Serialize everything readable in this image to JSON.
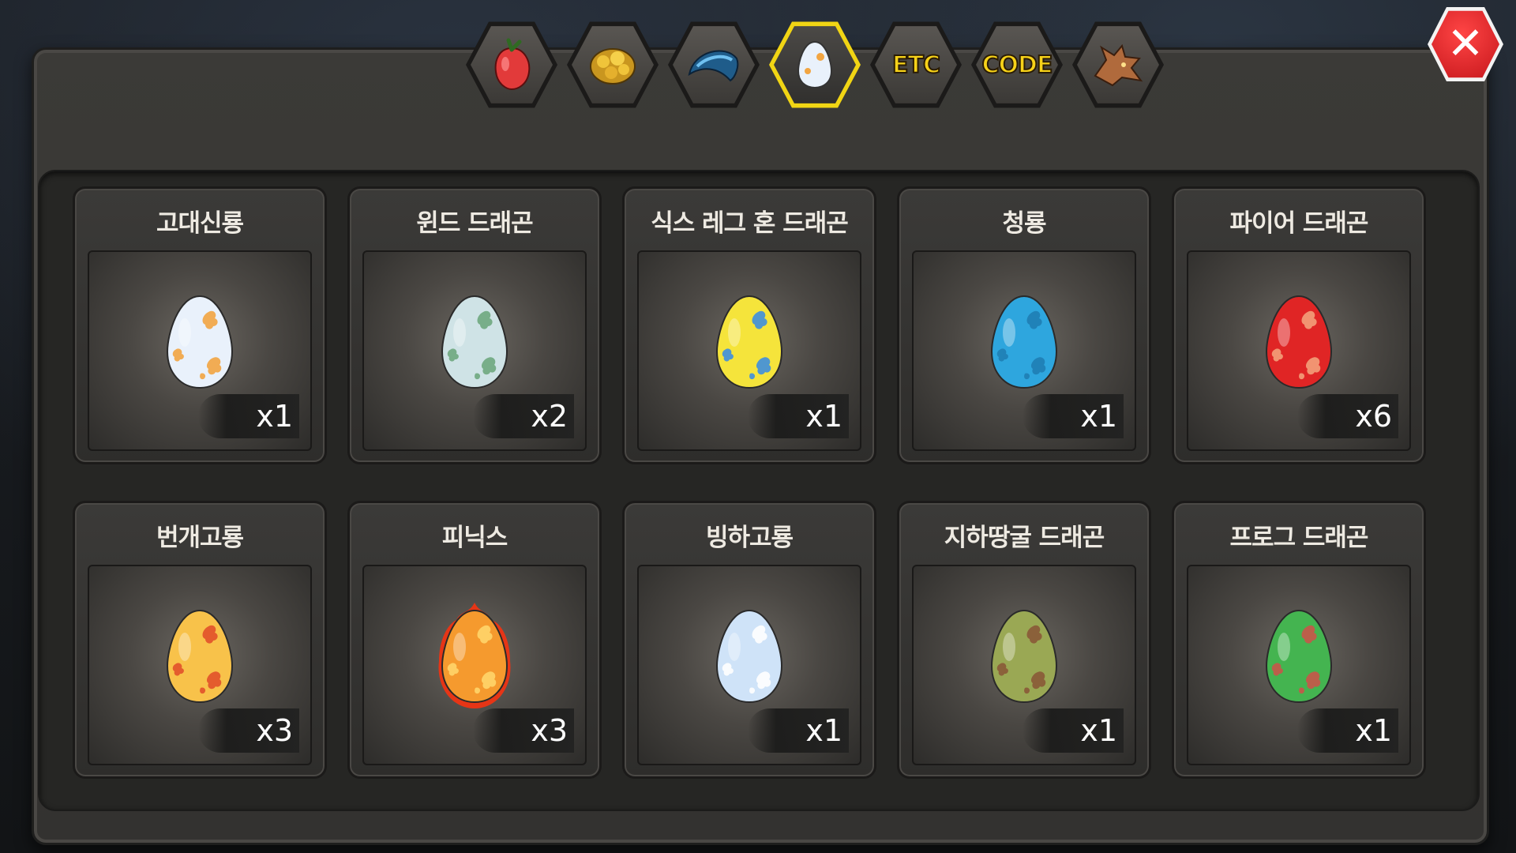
{
  "tabs": [
    {
      "name": "fruit-tab",
      "icon": "red-fruit-icon"
    },
    {
      "name": "gold-tab",
      "icon": "gold-nugget-icon"
    },
    {
      "name": "scale-tab",
      "icon": "blue-scale-icon"
    },
    {
      "name": "egg-tab",
      "icon": "egg-icon",
      "active": true
    },
    {
      "name": "etc-tab",
      "label": "ETC"
    },
    {
      "name": "code-tab",
      "label": "CODE"
    },
    {
      "name": "dragon-tab",
      "icon": "dragon-head-icon"
    }
  ],
  "close_icon": "close-x-icon",
  "eggs": [
    {
      "name": "고대신룡",
      "qty": "x1",
      "base": "#e9f1fb",
      "spot": "#f2a542"
    },
    {
      "name": "윈드 드래곤",
      "qty": "x2",
      "base": "#cfe3e6",
      "spot": "#6fa980"
    },
    {
      "name": "식스 레그 혼 드래곤",
      "qty": "x1",
      "base": "#f5e43b",
      "spot": "#3f8fe0"
    },
    {
      "name": "청룡",
      "qty": "x1",
      "base": "#2ea6de",
      "spot": "#1f7fb4"
    },
    {
      "name": "파이어 드래곤",
      "qty": "x6",
      "base": "#e02525",
      "spot": "#f3a07a"
    },
    {
      "name": "번개고룡",
      "qty": "x3",
      "base": "#f8c24a",
      "spot": "#e2512a"
    },
    {
      "name": "피닉스",
      "qty": "x3",
      "base": "#f59a2e",
      "spot": "#ffd56a",
      "fire": true
    },
    {
      "name": "빙하고룡",
      "qty": "x1",
      "base": "#cfe3f8",
      "spot": "#ffffff"
    },
    {
      "name": "지하땅굴 드래곤",
      "qty": "x1",
      "base": "#9aa854",
      "spot": "#8a5a38"
    },
    {
      "name": "프로그 드래곤",
      "qty": "x1",
      "base": "#44b450",
      "spot": "#c8564a"
    }
  ]
}
